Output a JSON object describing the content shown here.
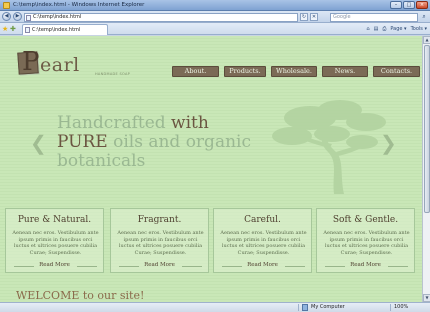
{
  "window": {
    "title": "C:\\temp\\index.html - Windows Internet Explorer",
    "minimize_label": "–",
    "maximize_label": "□",
    "close_label": "×"
  },
  "toolbar": {
    "back_label": "◀",
    "forward_label": "▶",
    "address": "C:\\temp\\index.html",
    "refresh_label": "↻",
    "stop_label": "✕",
    "search_placeholder": "Google",
    "search_icon": "⌕"
  },
  "tabs": [
    {
      "label": "C:\\temp\\index.html"
    }
  ],
  "command_bar": {
    "home_icon": "⌂",
    "feeds_icon": "▤",
    "print_icon": "⎙",
    "page_label": "Page ▾",
    "tools_label": "Tools ▾"
  },
  "site": {
    "logo_initial": "P",
    "logo_rest": "earl",
    "logo_tagline": "HANDMADE SOAP",
    "nav": [
      "About.",
      "Products.",
      "Wholesale.",
      "News.",
      "Contacts."
    ],
    "hero": {
      "line1_light": "Handcrafted ",
      "line1_dark": "with",
      "line2_dark": "PURE",
      "line2_light": " oils and organic",
      "line3_light": "botanicals"
    },
    "arrow_left": "❮",
    "arrow_right": "❯",
    "cards": [
      {
        "title": "Pure & Natural.",
        "text": "Aenean nec eros. Vestibulum ante ipsum primis in faucibus orci luctus et ultrices posuere cubilia Curae; Suspendisse.",
        "more": "Read More"
      },
      {
        "title": "Fragrant.",
        "text": "Aenean nec eros. Vestibulum ante ipsum primis in faucibus orci luctus et ultrices posuere cubilia Curae; Suspendisse.",
        "more": "Read More"
      },
      {
        "title": "Careful.",
        "text": "Aenean nec eros. Vestibulum ante ipsum primis in faucibus orci luctus et ultrices posuere cubilia Curae; Suspendisse.",
        "more": "Read More"
      },
      {
        "title": "Soft & Gentle.",
        "text": "Aenean nec eros. Vestibulum ante ipsum primis in faucibus orci luctus et ultrices posuere cubilia Curae; Suspendisse.",
        "more": "Read More"
      }
    ],
    "welcome": "WELCOME to our site!"
  },
  "status": {
    "zone": "My Computer",
    "zoom": "100%"
  },
  "colors": {
    "page_green": "#c9e7b7",
    "brand_brown": "#7b6a56",
    "title_blue": "#7fa2d2"
  }
}
